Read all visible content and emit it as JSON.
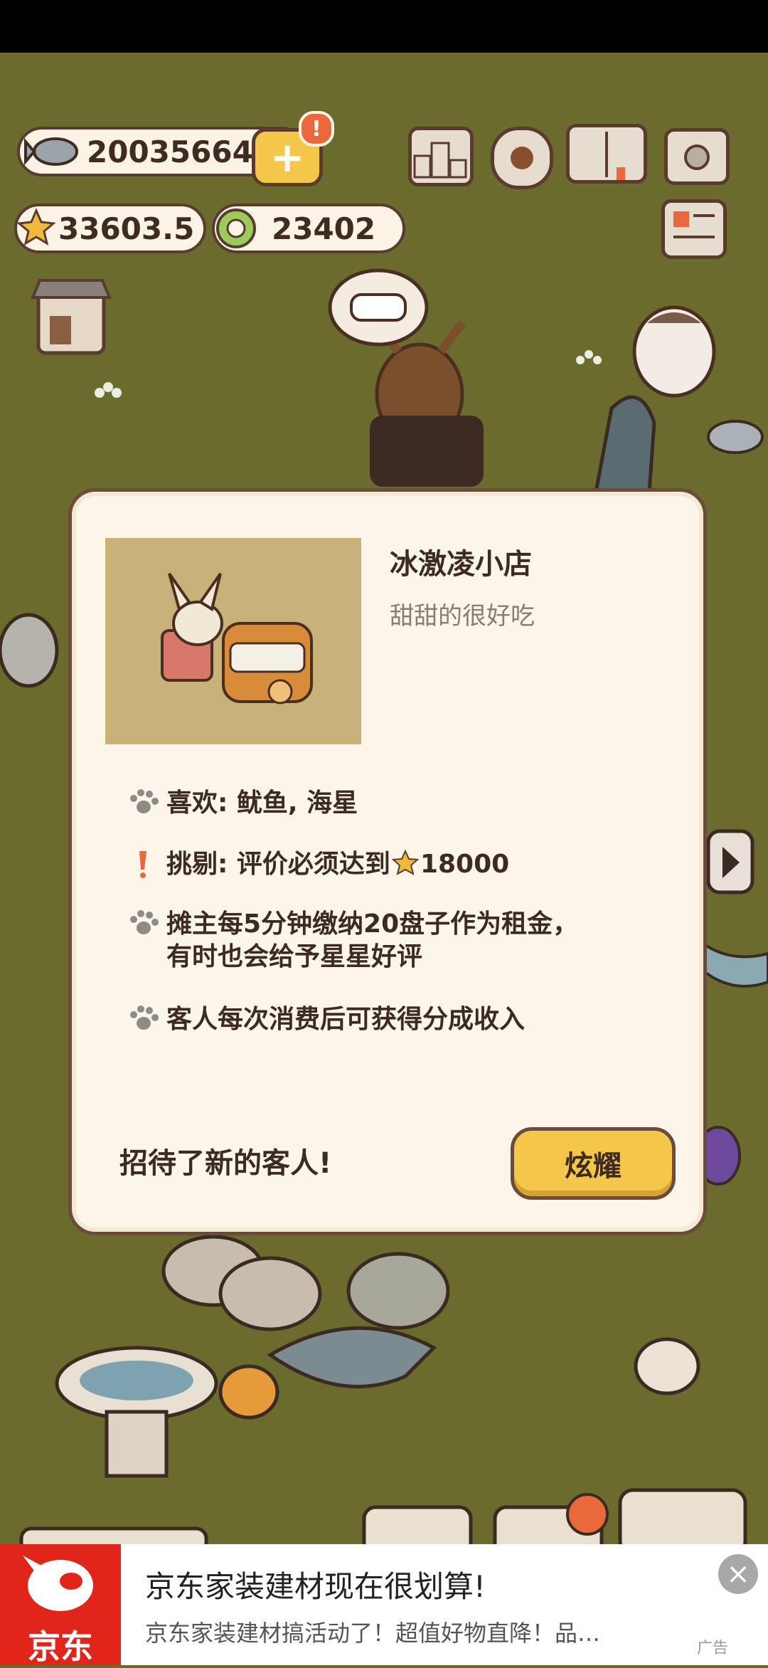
{
  "hud": {
    "fish_count": "20035664",
    "star_count": "33603.5",
    "coin_count": "23402",
    "add_symbol": "+",
    "alert_symbol": "!"
  },
  "modal": {
    "title": "冰激凌小店",
    "subtitle": "甜甜的很好吃",
    "rows": [
      {
        "icon": "paw-icon",
        "text": "喜欢: 鱿鱼, 海星"
      },
      {
        "icon": "exclamation-icon",
        "text_prefix": "挑剔: 评价必须达到",
        "text_value": "18000"
      },
      {
        "icon": "paw-icon",
        "text_line1": "摊主每5分钟缴纳20盘子作为租金，",
        "text_line2": "有时也会给予星星好评"
      },
      {
        "icon": "paw-icon",
        "text": "客人每次消费后可获得分成收入"
      }
    ],
    "footer_text": "招待了新的客人!",
    "share_button": "炫耀"
  },
  "ad": {
    "brand": "京东",
    "title": "京东家装建材现在很划算!",
    "subtitle": "京东家装建材搞活动了！超值好物直降！品…",
    "tag": "广告",
    "close": "×"
  },
  "colors": {
    "grass": "#6c6b2e",
    "panel": "#fbf5ea",
    "border": "#6b4b3c",
    "button": "#f4c64a",
    "ad_red": "#e1251b"
  }
}
